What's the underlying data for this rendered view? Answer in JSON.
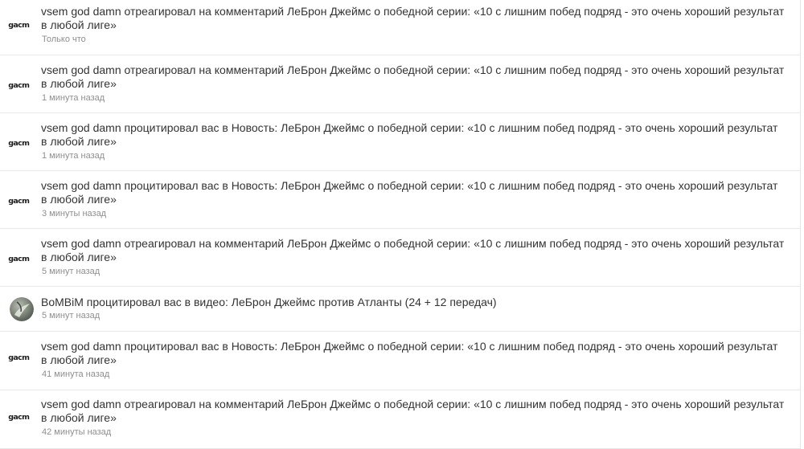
{
  "notifications": [
    {
      "avatar_label": "gacm",
      "text": "vsem god damn отреагировал на комментарий ЛеБрон Джеймс о победной серии: «10 с лишним побед подряд - это очень хороший результат в любой лиге»",
      "time": "Только что"
    },
    {
      "avatar_label": "gacm",
      "text": "vsem god damn отреагировал на комментарий ЛеБрон Джеймс о победной серии: «10 с лишним побед подряд - это очень хороший результат в любой лиге»",
      "time": "1 минута назад"
    },
    {
      "avatar_label": "gacm",
      "text": "vsem god damn процитировал вас в Новость: ЛеБрон Джеймс о победной серии: «10 с лишним побед подряд - это очень хороший результат в любой лиге»",
      "time": "1 минута назад"
    },
    {
      "avatar_label": "gacm",
      "text": "vsem god damn процитировал вас в Новость: ЛеБрон Джеймс о победной серии: «10 с лишним побед подряд - это очень хороший результат в любой лиге»",
      "time": "3 минуты назад"
    },
    {
      "avatar_label": "gacm",
      "text": "vsem god damn отреагировал на комментарий ЛеБрон Джеймс о победной серии: «10 с лишним побед подряд - это очень хороший результат в любой лиге»",
      "time": "5 минут назад"
    },
    {
      "avatar_label": "",
      "text": "BoMBiM процитировал вас в видео: ЛеБрон Джеймс против Атланты (24 + 12 передач)",
      "time": "5 минут назад"
    },
    {
      "avatar_label": "gacm",
      "text": "vsem god damn процитировал вас в Новость: ЛеБрон Джеймс о победной серии: «10 с лишним побед подряд - это очень хороший результат в любой лиге»",
      "time": "41 минута назад"
    },
    {
      "avatar_label": "gacm",
      "text": "vsem god damn отреагировал на комментарий ЛеБрон Джеймс о победной серии: «10 с лишним побед подряд - это очень хороший результат в любой лиге»",
      "time": "42 минуты назад"
    }
  ]
}
